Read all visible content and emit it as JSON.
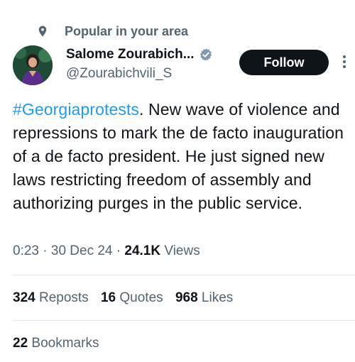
{
  "context": {
    "text": "Popular in your area",
    "icon": "location-pin-icon"
  },
  "author": {
    "name": "Salome Zourabich...",
    "handle": "@Zourabichvili_S",
    "verified": true,
    "avatar_alt": "avatar"
  },
  "actions": {
    "follow_label": "Follow",
    "more_icon": "more-vertical-icon"
  },
  "tweet": {
    "hashtag": "#Georgiaprotests",
    "body": ". New wave of violence and repressions to mark  the de facto inauguration of a de facto president. He just signed new laws restricting freedom of assembly and authorizing purges in the public service."
  },
  "meta": {
    "time": "0:23",
    "sep1": "·",
    "date": "30 Dec 24",
    "sep2": "·",
    "views_count": "24.1K",
    "views_label": "Views"
  },
  "stats": {
    "reposts_count": "324",
    "reposts_label": "Reposts",
    "quotes_count": "16",
    "quotes_label": "Quotes",
    "likes_count": "968",
    "likes_label": "Likes"
  },
  "bookmarks": {
    "count": "22",
    "label": "Bookmarks"
  },
  "colors": {
    "link": "#1d9bf0",
    "muted": "#536471",
    "text": "#0f1419",
    "verified": "#829aab"
  }
}
